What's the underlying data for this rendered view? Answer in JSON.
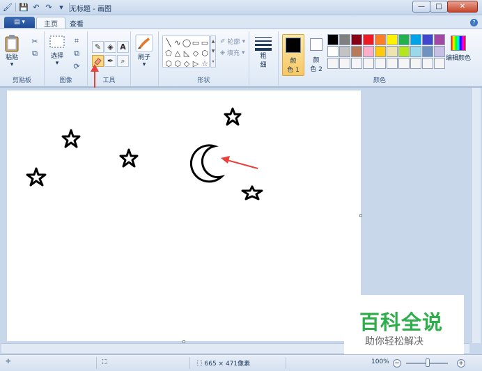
{
  "window": {
    "title": "无标题 - 画图",
    "controls": {
      "minimize": "—",
      "maximize": "□",
      "close": "✕"
    }
  },
  "quick_access": [
    "paint-app-icon",
    "save-icon",
    "undo-icon",
    "redo-icon",
    "customize-arrow-icon"
  ],
  "tabs": {
    "app_menu_glyph": "▤ ▾",
    "home": "主页",
    "view": "查看",
    "help_glyph": "?"
  },
  "ribbon": {
    "clipboard": {
      "paste": "粘贴",
      "group": "剪贴板"
    },
    "image": {
      "select": "选择",
      "group": "图像"
    },
    "tools": {
      "group": "工具",
      "text_glyph": "A",
      "selected_tool": "eraser"
    },
    "brushes": {
      "label": "刷子"
    },
    "shapes": {
      "outline": "轮廓",
      "fill": "填充",
      "group": "形状",
      "glyphs": [
        "╲",
        "∿",
        "◯",
        "▭",
        "▭",
        "⬠",
        "△",
        "◺",
        "◇",
        "⬡",
        "⬡",
        "⬡",
        "◇",
        "▷",
        "☆"
      ]
    },
    "size": {
      "label_line1": "粗",
      "label_line2": "细"
    },
    "colors": {
      "color1_line1": "颜",
      "color1_line2": "色 1",
      "color2_line1": "颜",
      "color2_line2": "色 2",
      "edit": "编辑颜色",
      "group": "颜色",
      "color1_value": "#000000",
      "color2_value": "#ffffff",
      "palette": [
        "#000000",
        "#7f7f7f",
        "#880015",
        "#ed1c24",
        "#ff7f27",
        "#fff200",
        "#22b14c",
        "#00a2e8",
        "#3f48cc",
        "#a349a4",
        "#ffffff",
        "#c3c3c3",
        "#b97a57",
        "#ffaec9",
        "#ffc90e",
        "#efe4b0",
        "#b5e61d",
        "#99d9ea",
        "#7092be",
        "#c8bfe7",
        "#f5f5f5",
        "#f5f5f5",
        "#f5f5f5",
        "#f5f5f5",
        "#f5f5f5",
        "#f5f5f5",
        "#f5f5f5",
        "#f5f5f5",
        "#f5f5f5",
        "#f5f5f5"
      ]
    }
  },
  "status": {
    "cursor_pos": "",
    "selection_size": "",
    "image_size": "665 × 471像素",
    "zoom": "100%",
    "zoom_out": "−",
    "zoom_in": "+"
  },
  "watermark": {
    "brand": "百科全说",
    "slogan": "助你轻松解决"
  },
  "accents": {
    "annotation_arrow": "#e8403a",
    "watermark_green": "#2dae4a"
  }
}
